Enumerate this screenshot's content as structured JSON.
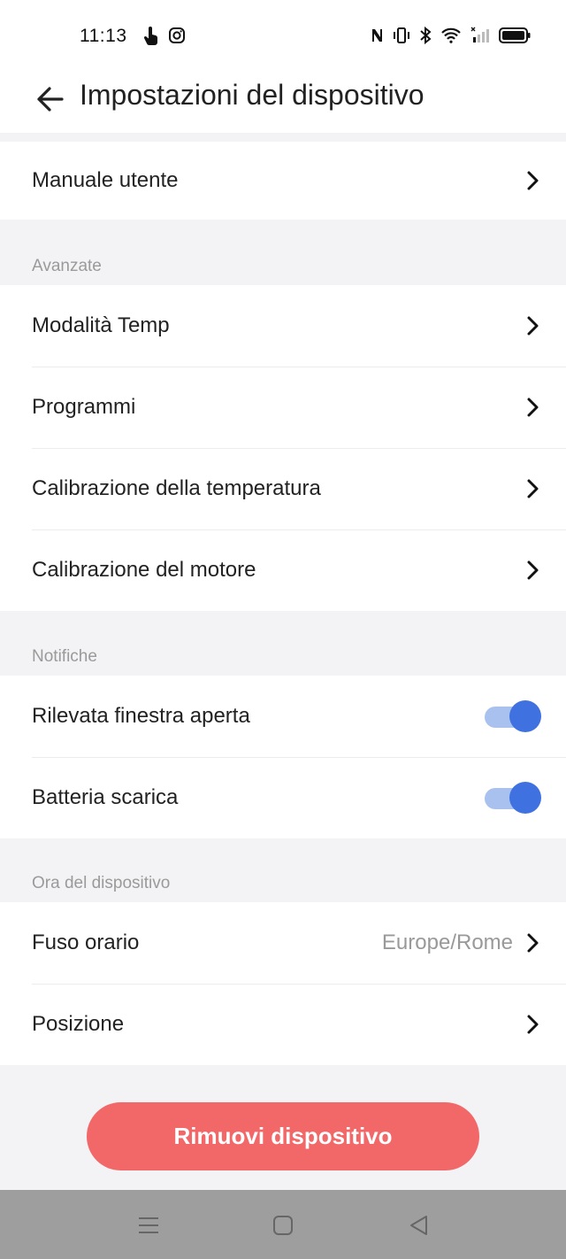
{
  "status_bar": {
    "time": "11:13",
    "left_icons": [
      "touch-hand-icon",
      "instagram-icon"
    ],
    "right_icons": [
      "nfc-icon",
      "vibrate-icon",
      "bluetooth-icon",
      "wifi-icon",
      "cell-signal-icon",
      "battery-icon"
    ]
  },
  "header": {
    "title": "Impostazioni del dispositivo"
  },
  "manual": {
    "label": "Manuale utente"
  },
  "advanced": {
    "section_label": "Avanzate",
    "items": [
      {
        "label": "Modalità Temp"
      },
      {
        "label": "Programmi"
      },
      {
        "label": "Calibrazione della temperatura"
      },
      {
        "label": "Calibrazione del motore"
      }
    ]
  },
  "notifications": {
    "section_label": "Notifiche",
    "items": [
      {
        "label": "Rilevata finestra aperta",
        "enabled": true
      },
      {
        "label": "Batteria scarica",
        "enabled": true
      }
    ]
  },
  "device_time": {
    "section_label": "Ora del dispositivo",
    "timezone": {
      "label": "Fuso orario",
      "value": "Europe/Rome"
    },
    "position": {
      "label": "Posizione"
    }
  },
  "remove_button": {
    "label": "Rimuovi dispositivo"
  },
  "colors": {
    "accent": "#3f72e0",
    "toggle_track": "#a9c1ee",
    "danger": "#f26869",
    "background": "#f3f3f5"
  },
  "nav_bar": {
    "buttons": [
      "menu-icon",
      "home-square-icon",
      "back-triangle-icon"
    ]
  }
}
